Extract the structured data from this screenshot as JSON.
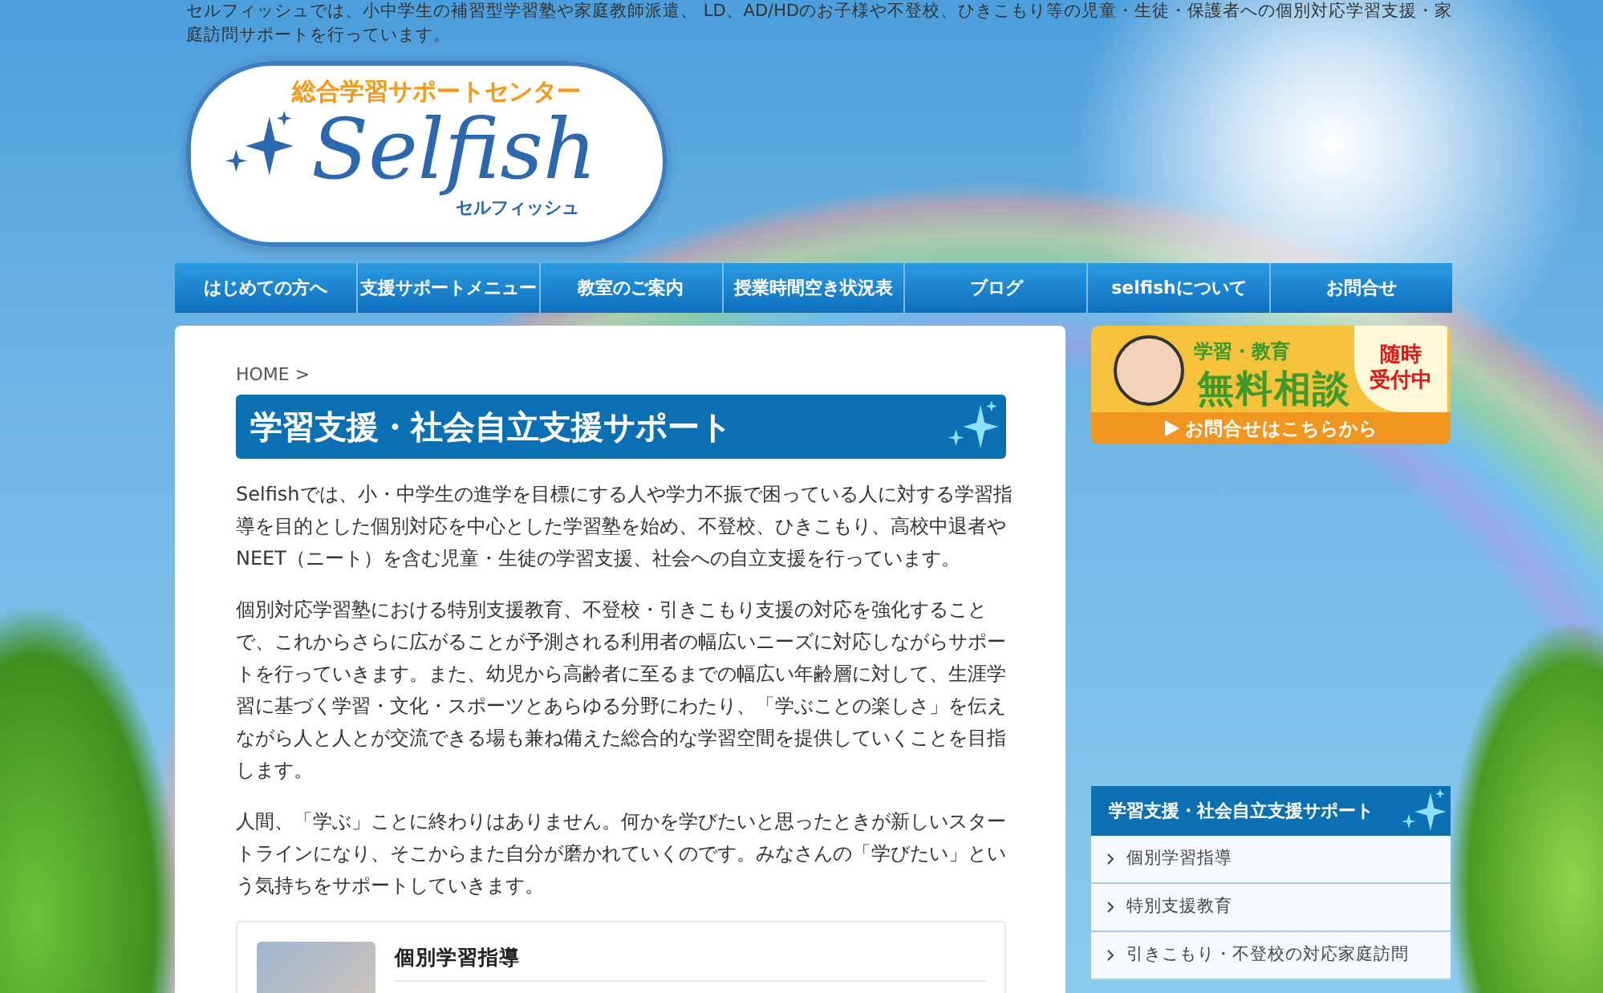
{
  "tagline": "セルフィッシュでは、小中学生の補習型学習塾や家庭教師派遣、 LD、AD/HDのお子様や不登校、ひきこもり等の児童・生徒・保護者への個別対応学習支援・家庭訪問サポートを行っています。",
  "logo": {
    "subtitle": "総合学習サポートセンター",
    "name": "Selfish",
    "kana": "セルフィッシュ"
  },
  "nav": [
    "はじめての方へ",
    "支援サポートメニュー",
    "教室のご案内",
    "授業時間空き状況表",
    "ブログ",
    "selfishについて",
    "お問合せ"
  ],
  "breadcrumb": "HOME >",
  "heading": "学習支援・社会自立支援サポート",
  "paragraphs": [
    "Selfishでは、小・中学生の進学を目標にする人や学力不振で困っている人に対する学習指導を目的とした個別対応を中心とした学習塾を始め、不登校、ひきこもり、高校中退者やNEET（ニート）を含む児童・生徒の学習支援、社会への自立支援を行っています。",
    "個別対応学習塾における特別支援教育、不登校・引きこもり支援の対応を強化することで、これからさらに広がることが予測される利用者の幅広いニーズに対応しながらサポートを行っていきます。また、幼児から高齢者に至るまでの幅広い年齢層に対して、生涯学習に基づく学習・文化・スポーツとあらゆる分野にわたり、「学ぶことの楽しさ」を伝えながら人と人とが交流できる場も兼ね備えた総合的な学習空間を提供していくことを目指します。",
    "人間、「学ぶ」ことに終わりはありません。何かを学びたいと思ったときが新しいスタートラインになり、そこからまた自分が磨かれていくのです。みなさんの「学びたい」という気持ちをサポートしていきます。"
  ],
  "card": {
    "title": "個別学習指導"
  },
  "banner": {
    "label": "学習・教育",
    "title": "無料相談",
    "badge": [
      "随時",
      "受付中"
    ],
    "cta": "お問合せはこちらから"
  },
  "side_menu": {
    "title": "学習支援・社会自立支援サポート",
    "items": [
      "個別学習指導",
      "特別支援教育",
      "引きこもり・不登校の対応家庭訪問"
    ]
  }
}
